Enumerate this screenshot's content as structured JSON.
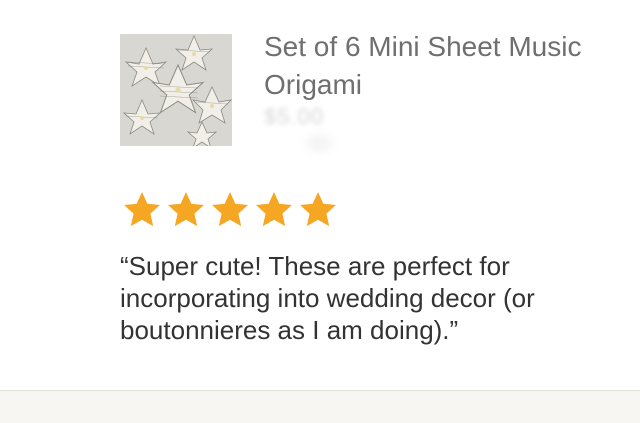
{
  "product": {
    "title": "Set of 6 Mini Sheet Music Origami",
    "price": "$5.00",
    "image_alt": "sheet music origami flowers"
  },
  "review": {
    "rating": 5,
    "rating_max": 5,
    "star_color": "#f5a623",
    "text": "“Super cute! These are perfect for incorporating into wedding decor (or boutonnieres as I am doing).”"
  },
  "colors": {
    "background": "#ffffff",
    "footer": "#f7f6f3",
    "title_text": "#6f6f6f",
    "review_text": "#333333"
  }
}
